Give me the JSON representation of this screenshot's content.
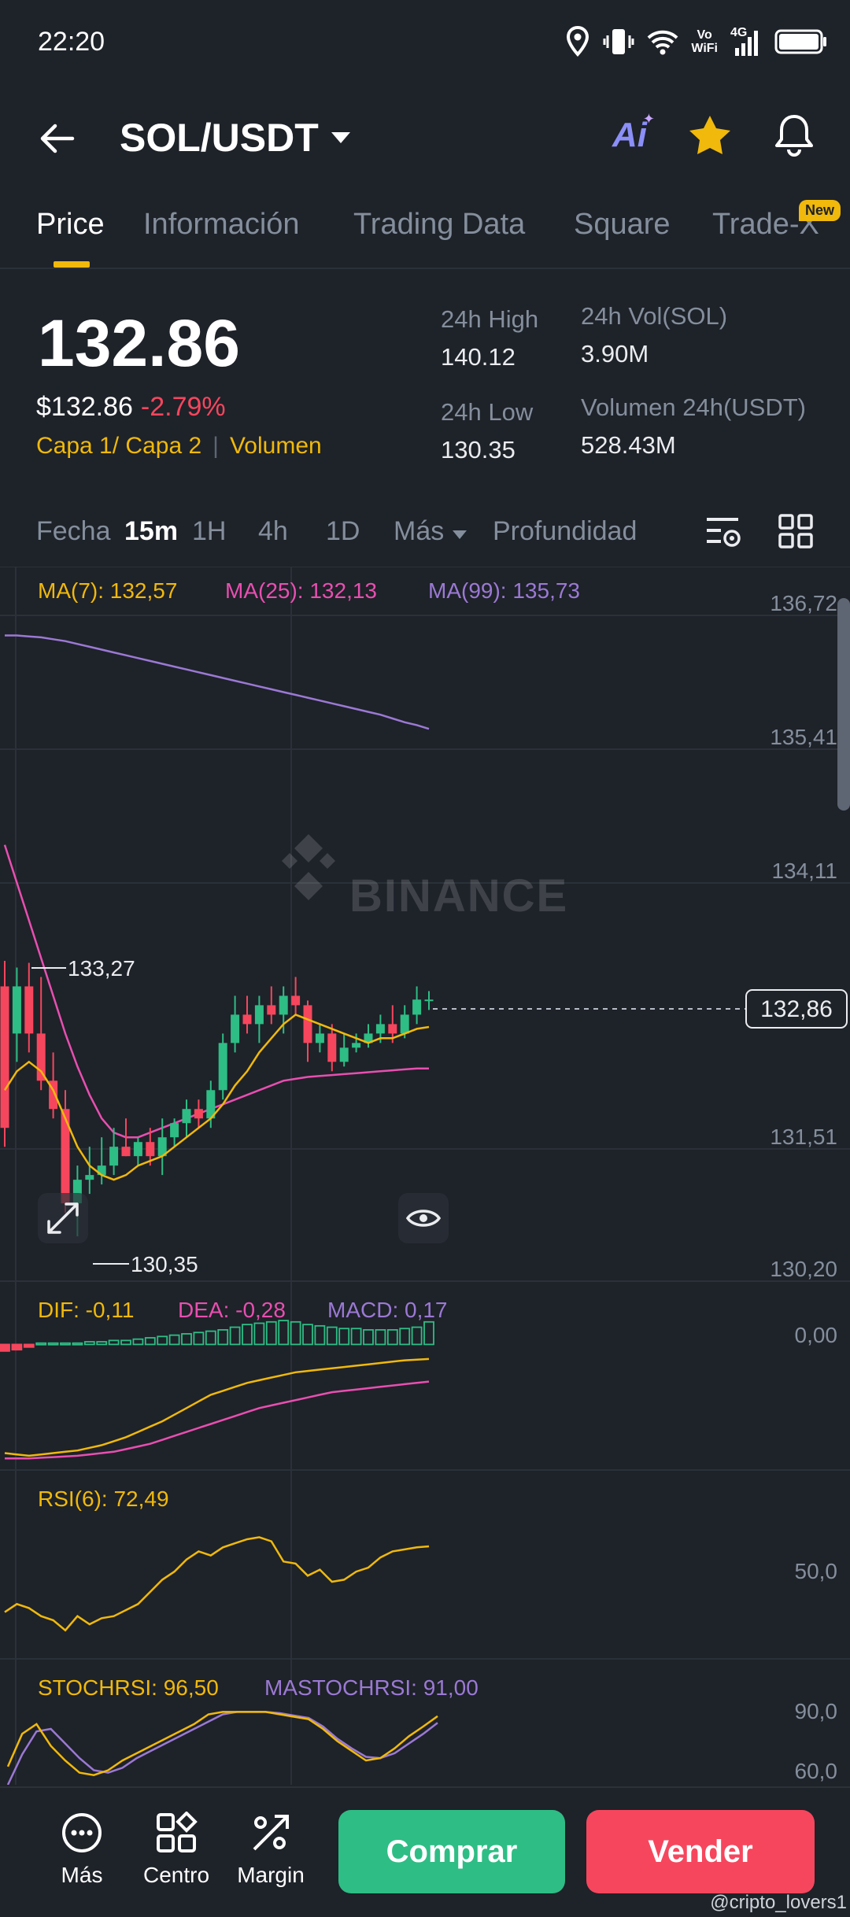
{
  "status": {
    "time": "22:20",
    "vo": "Vo",
    "wifi": "WiFi",
    "net": "4G"
  },
  "header": {
    "pair": "SOL/USDT",
    "ai_label": "Ai"
  },
  "tabs": [
    "Price",
    "Información",
    "Trading Data",
    "Square",
    "Trade-X"
  ],
  "new_badge": "New",
  "ticker": {
    "price": "132.86",
    "usd_price": "$132.86",
    "change": "-2.79%",
    "layer": "Capa 1/ Capa 2",
    "volume_tag": "Volumen",
    "high_label": "24h High",
    "high_value": "140.12",
    "low_label": "24h Low",
    "low_value": "130.35",
    "vol_sol_label": "24h Vol(SOL)",
    "vol_sol_value": "3.90M",
    "vol_usdt_label": "Volumen 24h(USDT)",
    "vol_usdt_value": "528.43M"
  },
  "intervals": [
    "Fecha",
    "15m",
    "1H",
    "4h",
    "1D",
    "Más",
    "Profundidad"
  ],
  "colors": {
    "up": "#2ebd85",
    "down": "#f6465d",
    "ma7": "#f0b90b",
    "ma25": "#e84fb0",
    "ma99": "#9b79d4",
    "accent": "#f0b90b"
  },
  "chart_data": {
    "type": "candlestick",
    "main": {
      "legend": {
        "ma7": "MA(7): 132,57",
        "ma25": "MA(25): 132,13",
        "ma99": "MA(99): 135,73"
      },
      "y_ticks": [
        "136,72",
        "135,41",
        "134,11",
        "131,51",
        "130,20"
      ],
      "last_price": "132,86",
      "max_label": "133,27",
      "min_label": "130,35",
      "watermark": "BINANCE",
      "ohlc": [
        [
          133.0,
          133.27,
          131.3,
          131.5
        ],
        [
          132.5,
          133.2,
          132.2,
          133.0
        ],
        [
          133.0,
          133.25,
          132.3,
          132.5
        ],
        [
          132.5,
          133.1,
          131.9,
          132.0
        ],
        [
          132.0,
          132.3,
          131.6,
          131.7
        ],
        [
          131.7,
          131.9,
          130.6,
          130.7
        ],
        [
          130.7,
          131.1,
          130.35,
          130.95
        ],
        [
          130.95,
          131.3,
          130.8,
          131.0
        ],
        [
          131.0,
          131.4,
          130.9,
          131.1
        ],
        [
          131.1,
          131.5,
          131.0,
          131.3
        ],
        [
          131.3,
          131.6,
          131.2,
          131.2
        ],
        [
          131.2,
          131.4,
          131.1,
          131.35
        ],
        [
          131.35,
          131.5,
          131.1,
          131.2
        ],
        [
          131.2,
          131.6,
          131.0,
          131.4
        ],
        [
          131.4,
          131.6,
          131.3,
          131.55
        ],
        [
          131.55,
          131.8,
          131.4,
          131.7
        ],
        [
          131.7,
          131.8,
          131.5,
          131.6
        ],
        [
          131.6,
          132.0,
          131.5,
          131.9
        ],
        [
          131.9,
          132.5,
          131.8,
          132.4
        ],
        [
          132.4,
          132.9,
          132.3,
          132.7
        ],
        [
          132.7,
          132.9,
          132.5,
          132.6
        ],
        [
          132.6,
          132.9,
          132.4,
          132.8
        ],
        [
          132.8,
          133.0,
          132.6,
          132.7
        ],
        [
          132.7,
          133.0,
          132.5,
          132.9
        ],
        [
          132.9,
          133.1,
          132.7,
          132.8
        ],
        [
          132.8,
          132.85,
          132.2,
          132.4
        ],
        [
          132.4,
          132.6,
          132.3,
          132.5
        ],
        [
          132.5,
          132.6,
          132.1,
          132.2
        ],
        [
          132.2,
          132.5,
          132.15,
          132.35
        ],
        [
          132.35,
          132.5,
          132.3,
          132.4
        ],
        [
          132.4,
          132.6,
          132.35,
          132.5
        ],
        [
          132.5,
          132.7,
          132.4,
          132.6
        ],
        [
          132.6,
          132.8,
          132.4,
          132.5
        ],
        [
          132.5,
          132.8,
          132.45,
          132.7
        ],
        [
          132.7,
          133.0,
          132.6,
          132.86
        ],
        [
          132.86,
          132.95,
          132.75,
          132.86
        ]
      ],
      "ma7": [
        131.9,
        132.1,
        132.2,
        132.1,
        131.9,
        131.6,
        131.3,
        131.1,
        131.0,
        130.95,
        131.0,
        131.1,
        131.15,
        131.2,
        131.3,
        131.4,
        131.5,
        131.6,
        131.75,
        131.95,
        132.1,
        132.3,
        132.45,
        132.6,
        132.7,
        132.65,
        132.6,
        132.55,
        132.5,
        132.45,
        132.4,
        132.45,
        132.45,
        132.5,
        132.55,
        132.57
      ],
      "ma25": [
        134.5,
        134.1,
        133.7,
        133.3,
        132.9,
        132.5,
        132.15,
        131.85,
        131.6,
        131.45,
        131.4,
        131.4,
        131.45,
        131.5,
        131.55,
        131.6,
        131.65,
        131.7,
        131.75,
        131.8,
        131.85,
        131.9,
        131.95,
        132.0,
        132.02,
        132.04,
        132.05,
        132.06,
        132.07,
        132.08,
        132.09,
        132.1,
        132.11,
        132.12,
        132.13,
        132.13
      ],
      "ma99": [
        136.72,
        136.72,
        136.71,
        136.7,
        136.68,
        136.66,
        136.63,
        136.6,
        136.57,
        136.54,
        136.51,
        136.48,
        136.45,
        136.42,
        136.39,
        136.36,
        136.33,
        136.3,
        136.27,
        136.24,
        136.21,
        136.18,
        136.15,
        136.12,
        136.09,
        136.06,
        136.03,
        136.0,
        135.97,
        135.94,
        135.91,
        135.88,
        135.84,
        135.8,
        135.77,
        135.73
      ],
      "ylim": [
        129.9,
        137.2
      ]
    },
    "macd": {
      "legend": {
        "dif": "DIF: -0,11",
        "dea": "DEA: -0,28",
        "macd": "MACD: 0,17"
      },
      "y_ticks": [
        "0,00"
      ],
      "hist": [
        -0.05,
        -0.04,
        -0.02,
        0.01,
        0.01,
        0.01,
        0.01,
        0.02,
        0.02,
        0.03,
        0.03,
        0.04,
        0.05,
        0.06,
        0.07,
        0.08,
        0.09,
        0.1,
        0.11,
        0.13,
        0.15,
        0.16,
        0.17,
        0.18,
        0.17,
        0.15,
        0.14,
        0.13,
        0.12,
        0.12,
        0.11,
        0.11,
        0.11,
        0.12,
        0.13,
        0.17
      ],
      "dif": [
        -0.82,
        -0.83,
        -0.84,
        -0.83,
        -0.82,
        -0.81,
        -0.8,
        -0.78,
        -0.76,
        -0.73,
        -0.7,
        -0.66,
        -0.62,
        -0.58,
        -0.53,
        -0.48,
        -0.43,
        -0.38,
        -0.35,
        -0.32,
        -0.29,
        -0.27,
        -0.25,
        -0.23,
        -0.21,
        -0.2,
        -0.19,
        -0.18,
        -0.17,
        -0.16,
        -0.15,
        -0.14,
        -0.13,
        -0.12,
        -0.115,
        -0.11
      ],
      "dea": [
        -0.86,
        -0.86,
        -0.86,
        -0.855,
        -0.85,
        -0.845,
        -0.84,
        -0.83,
        -0.82,
        -0.81,
        -0.79,
        -0.77,
        -0.75,
        -0.72,
        -0.69,
        -0.66,
        -0.63,
        -0.6,
        -0.57,
        -0.54,
        -0.51,
        -0.48,
        -0.46,
        -0.44,
        -0.42,
        -0.4,
        -0.38,
        -0.36,
        -0.35,
        -0.34,
        -0.33,
        -0.32,
        -0.31,
        -0.3,
        -0.29,
        -0.28
      ],
      "ylim": [
        -0.9,
        0.05
      ]
    },
    "rsi": {
      "legend": {
        "rsi": "RSI(6): 72,49"
      },
      "y_ticks": [
        "50,0"
      ],
      "values": [
        40,
        44,
        42,
        38,
        36,
        31,
        38,
        34,
        37,
        38,
        41,
        44,
        50,
        56,
        60,
        66,
        70,
        68,
        72,
        74,
        76,
        77,
        75,
        65,
        64,
        58,
        61,
        55,
        56,
        60,
        62,
        67,
        70,
        71,
        72,
        72.49
      ],
      "ylim": [
        20,
        90
      ]
    },
    "stochrsi": {
      "legend": {
        "stoch": "STOCHRSI: 96,50",
        "ma": "MASTOCHRSI: 91,00"
      },
      "y_ticks": [
        "90,0",
        "60,0"
      ],
      "stoch": [
        55,
        82,
        90,
        72,
        60,
        50,
        48,
        52,
        60,
        66,
        72,
        78,
        84,
        90,
        98,
        100,
        100,
        100,
        100,
        98,
        96,
        94,
        86,
        76,
        68,
        60,
        62,
        70,
        80,
        88,
        96.5
      ],
      "ma": [
        40,
        65,
        84,
        86,
        74,
        62,
        52,
        50,
        54,
        62,
        68,
        74,
        80,
        86,
        92,
        98,
        100,
        100,
        100,
        99,
        97,
        95,
        88,
        78,
        70,
        63,
        62,
        66,
        74,
        82,
        91
      ],
      "ylim": [
        40,
        110
      ]
    }
  },
  "bottom": {
    "mas": "Más",
    "centro": "Centro",
    "margin": "Margin",
    "buy": "Comprar",
    "sell": "Vender",
    "user": "@cripto_lovers1"
  }
}
